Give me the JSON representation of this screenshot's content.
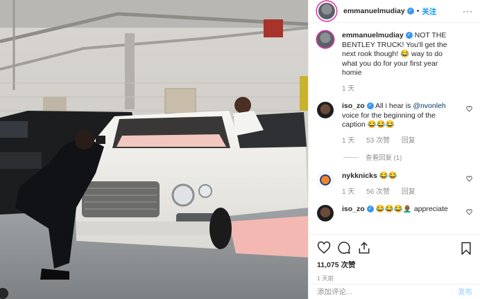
{
  "post": {
    "username": "emmanuelmudiay",
    "follow_label": "关注",
    "more_label": "···"
  },
  "caption": {
    "username": "emmanuelmudiay",
    "text": "NOT THE BENTLEY TRUCK! You'll get the next rook though! 😂 way to do what you do for your first year homie",
    "time": "1 天"
  },
  "comments": [
    {
      "username": "iso_zo",
      "text_pre": "All i hear is ",
      "mention": "@nvonleh",
      "text_post": " voice for the beginning of the caption 😂😂😂",
      "time": "1 天",
      "likes": "53 次赞",
      "reply": "回复"
    },
    {
      "username": "nykknicks",
      "text": "😂😂",
      "time": "1 天",
      "likes": "56 次赞",
      "reply": "回复"
    },
    {
      "username": "iso_zo",
      "text": "😂😂😂👨🏾‍🦲 appreciate",
      "time": "",
      "likes": "",
      "reply": ""
    }
  ],
  "view_replies": "查看回复 (1)",
  "likes_count": "11,075 次赞",
  "posted_ago": "1 天前",
  "add_comment_placeholder": "添加评论...",
  "post_button": "发布",
  "icons": [
    "heart-icon",
    "comment-icon",
    "share-icon",
    "bookmark-icon",
    "verified-icon"
  ],
  "colors": {
    "accent": "#0095f6",
    "verified": "#3897f0",
    "muted": "#8e8e8e"
  }
}
